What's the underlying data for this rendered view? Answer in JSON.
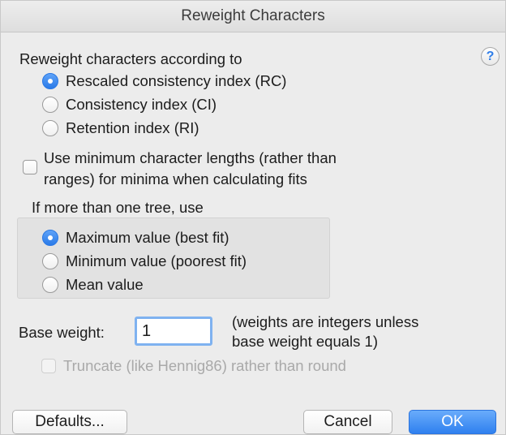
{
  "dialog": {
    "title": "Reweight Characters",
    "help_label": "?"
  },
  "reweight": {
    "heading": "Reweight characters according to",
    "options": [
      {
        "label": "Rescaled consistency index (RC)",
        "selected": true
      },
      {
        "label": "Consistency index (CI)",
        "selected": false
      },
      {
        "label": "Retention index (RI)",
        "selected": false
      }
    ]
  },
  "min_lengths": {
    "line1": "Use minimum character lengths (rather than",
    "line2": "ranges) for minima when calculating fits",
    "checked": false
  },
  "multi_tree": {
    "heading": "If more than one tree, use",
    "options": [
      {
        "label": "Maximum value (best fit)",
        "selected": true
      },
      {
        "label": "Minimum value (poorest fit)",
        "selected": false
      },
      {
        "label": "Mean value",
        "selected": false
      }
    ]
  },
  "base_weight": {
    "label": "Base weight:",
    "value": "1",
    "note_line1": "(weights are integers unless",
    "note_line2": "base weight equals 1)"
  },
  "truncate": {
    "label": "Truncate (like Hennig86) rather than round",
    "checked": false,
    "enabled": false
  },
  "buttons": {
    "defaults": "Defaults...",
    "cancel": "Cancel",
    "ok": "OK"
  },
  "colors": {
    "accent": "#2f80ef",
    "focus_ring": "#7fb2f0"
  }
}
